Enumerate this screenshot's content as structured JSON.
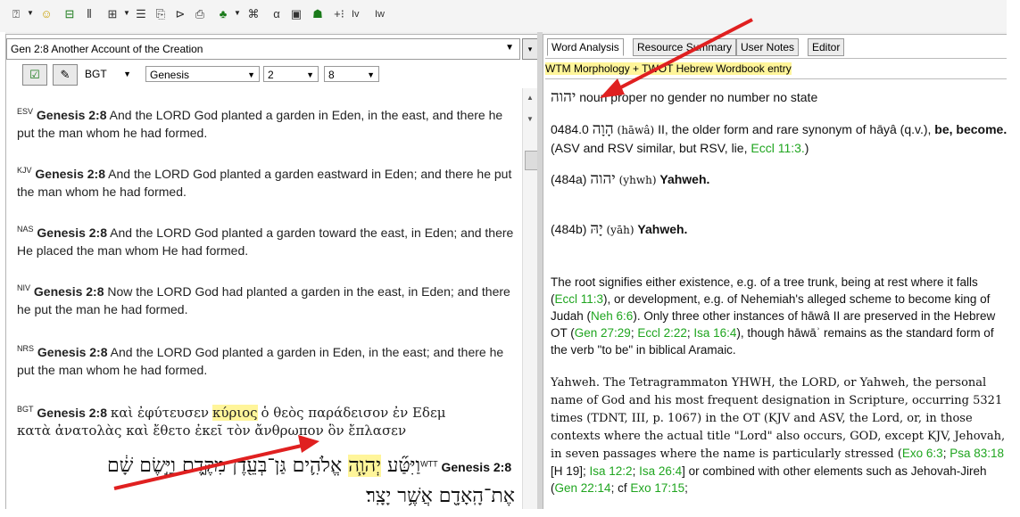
{
  "toolbar": {
    "text_items": [
      "Iv",
      "Iw"
    ]
  },
  "left": {
    "passage_title": "Gen 2:8 Another Account of the Creation",
    "version": "BGT",
    "book": "Genesis",
    "chapter": "2",
    "verse": "8",
    "verses": [
      {
        "abbr": "ESV",
        "ref": "Genesis 2:8",
        "text": "And the LORD God planted a garden in Eden, in the east, and there he put the man whom he had formed."
      },
      {
        "abbr": "KJV",
        "ref": "Genesis 2:8",
        "text": "And the LORD God planted a garden eastward in Eden; and there he put the man whom he had formed."
      },
      {
        "abbr": "NAS",
        "ref": "Genesis 2:8",
        "text": "And the LORD God planted a garden toward the east, in Eden; and there He placed the man whom He had formed."
      },
      {
        "abbr": "NIV",
        "ref": "Genesis 2:8",
        "text": "Now the LORD God had planted a garden in the east, in Eden; and there he put the man he had formed."
      },
      {
        "abbr": "NRS",
        "ref": "Genesis 2:8",
        "text": "And the LORD God planted a garden in Eden, in the east; and there he put the man whom he had formed."
      }
    ],
    "bgt": {
      "abbr": "BGT",
      "ref": "Genesis 2:8",
      "before": "καὶ ἐφύτευσεν",
      "highlight": "κύριος",
      "after_line1": "ὁ θεὸς παράδεισον ἐν Εδεμ",
      "line2": "κατὰ ἀνατολὰς καὶ ἔθετο ἐκεῖ τὸν ἄνθρωπον ὃν ἔπλασεν"
    },
    "wtt": {
      "abbr": "WTT",
      "ref": "Genesis 2:8",
      "line1_start": "וַיִּטַּ֞ע",
      "line1_highlight": "יְהוָ֧ה",
      "line1_rest": "אֱלֹהִ֛ים גַּן־בְּעֵ֖דֶן מִקֶּ֑דֶם וַיָּ֣שֶׂם שָׁ֔ם",
      "line2": "אֶת־הָֽאָדָ֖ם אֲשֶׁ֥ר יָצָֽר׃"
    }
  },
  "right": {
    "tabs": [
      "Word Analysis",
      "Resource Summary",
      "User Notes",
      "Editor"
    ],
    "source": "WTM Morphology + TWOT Hebrew Wordbook entry",
    "morph_word": "יהוה",
    "morph_desc": "noun proper no gender no number no state",
    "entry_num": "0484.0",
    "entry_word": "הָוָה",
    "entry_translit": "(hāwâ)",
    "entry_text": "II, the older form and rare synonym of hāyâ (q.v.),",
    "entry_bold": "be, become.",
    "entry_paren": "(ASV and RSV similar, but RSV, lie,",
    "entry_link": "Eccl 11:3.",
    "entry_close": ")",
    "sub_a_num": "(484a)",
    "sub_a_word": "יהוה",
    "sub_a_translit": "(yhwh)",
    "sub_a_gloss": "Yahweh.",
    "sub_b_num": "(484b)",
    "sub_b_word": "יָהּ",
    "sub_b_translit": "(yāh)",
    "sub_b_gloss": "Yahweh.",
    "root_p1": "The root signifies either existence, e.g. of a tree trunk, being at rest where it falls (",
    "root_link1": "Eccl 11:3",
    "root_p2": "), or development, e.g. of Nehemiah's alleged scheme to become king of Judah (",
    "root_link2": "Neh 6:6",
    "root_p3": "). Only three other instances of hāwâ II are preserved in the Hebrew OT (",
    "root_link3": "Gen 27:29",
    "root_sep1": "; ",
    "root_link4": "Eccl 2:22",
    "root_sep2": "; ",
    "root_link5": "Isa 16:4",
    "root_p4": "), though hāwāʾ remains as the standard form of the verb \"to be\" in biblical Aramaic.",
    "yah_p1": "Yahweh. The Tetragrammaton YHWH, the LORD, or Yahweh, the personal name of God and his most frequent designation in Scripture, occurring 5321 times (TDNT, III, p. 1067) in the OT (KJV and ASV, the Lord, or, in those contexts where the actual title \"Lord\" also occurs, GOD, except KJV, Jehovah, in seven passages where the name is particularly stressed (",
    "yah_link1": "Exo 6:3",
    "yah_sep1": "; ",
    "yah_link2": "Psa 83:18",
    "yah_p2": " [H 19]; ",
    "yah_link3": "Isa 12:2",
    "yah_sep2": "; ",
    "yah_link4": "Isa 26:4",
    "yah_p3": "] or combined with other elements such as Jehovah-Jireh (",
    "yah_link5": "Gen 22:14",
    "yah_p4": "; cf ",
    "yah_link6": "Exo 17:15",
    "yah_p5": ";"
  },
  "colors": {
    "highlight": "#fff59a",
    "link": "#1fa51f",
    "arrow": "#e02020"
  }
}
